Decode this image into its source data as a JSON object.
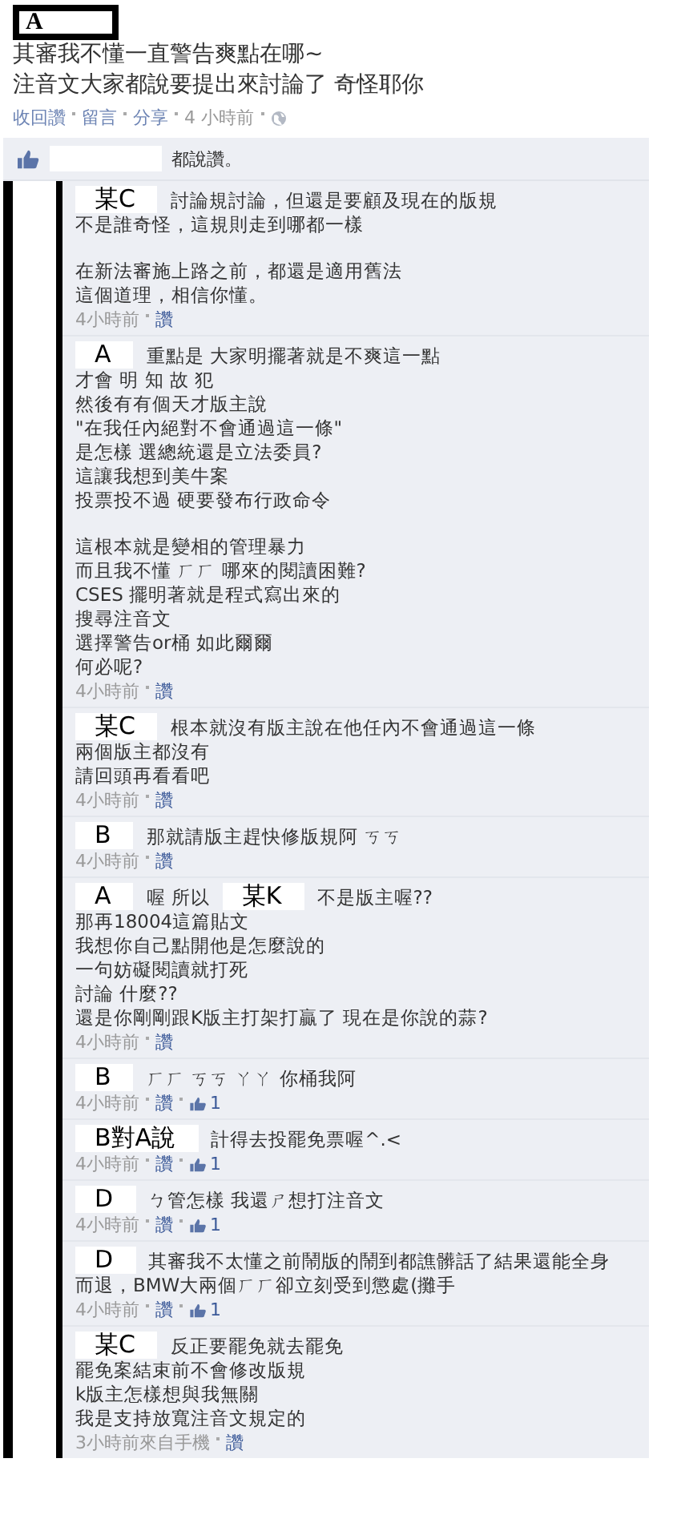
{
  "post": {
    "author": "A",
    "lines": [
      "其審我不懂一直警告爽點在哪~",
      "注音文大家都說要提出來討論了 奇怪耶你"
    ],
    "actions": [
      {
        "kind": "link",
        "text": "收回讚"
      },
      {
        "kind": "link",
        "text": "留言"
      },
      {
        "kind": "link",
        "text": "分享"
      },
      {
        "kind": "time",
        "text": "4 小時前"
      },
      {
        "kind": "globe"
      }
    ]
  },
  "likes_row": {
    "text": "都說讚。"
  },
  "comments": [
    {
      "author": "某C",
      "head": [
        {
          "kind": "text",
          "text": "討論規討論，但還是要顧及現在的版規"
        }
      ],
      "paragraphs": [
        [
          "不是誰奇怪，這規則走到哪都一樣"
        ],
        [
          "在新法審施上路之前，都還是適用舊法",
          "這個道理，相信你懂。"
        ]
      ],
      "time": "4小時前",
      "like": "讚"
    },
    {
      "author": "A",
      "head": [
        {
          "kind": "text",
          "text": "重點是 大家明擺著就是不爽這一點"
        }
      ],
      "paragraphs": [
        [
          "才會 明 知 故 犯",
          "然後有有個天才版主說",
          "\"在我任內絕對不會通過這一條\"",
          "是怎樣 選總統還是立法委員?",
          "這讓我想到美牛案",
          "投票投不過 硬要發布行政命令"
        ],
        [
          "這根本就是變相的管理暴力",
          "而且我不懂 ㄏㄏ 哪來的閱讀困難?",
          "CSES 擺明著就是程式寫出來的",
          "搜尋注音文",
          "選擇警告or桶 如此爾爾",
          "何必呢?"
        ]
      ],
      "time": "4小時前",
      "like": "讚"
    },
    {
      "author": "某C",
      "head": [
        {
          "kind": "text",
          "text": "根本就沒有版主說在他任內不會通過這一條"
        }
      ],
      "paragraphs": [
        [
          "兩個版主都沒有",
          "請回頭再看看吧"
        ]
      ],
      "time": "4小時前",
      "like": "讚"
    },
    {
      "author": "B",
      "head": [
        {
          "kind": "text",
          "text": "那就請版主趕快修版規阿 ㄎㄎ"
        }
      ],
      "time": "4小時前",
      "like": "讚"
    },
    {
      "author": "A",
      "head": [
        {
          "kind": "text",
          "text": "喔 所以"
        },
        {
          "kind": "name",
          "text": "某K"
        },
        {
          "kind": "text",
          "text": "不是版主喔??"
        }
      ],
      "paragraphs": [
        [
          "那再18004這篇貼文",
          "我想你自己點開他是怎麼說的",
          "一句妨礙閱讀就打死",
          "討論 什麼??",
          "還是你剛剛跟K版主打架打贏了 現在是你說的蒜?"
        ]
      ],
      "time": "4小時前",
      "like": "讚"
    },
    {
      "author": "B",
      "head": [
        {
          "kind": "text",
          "text": "ㄏㄏ ㄎㄎ ㄚㄚ 你桶我阿"
        }
      ],
      "time": "4小時前",
      "like": "讚",
      "likes": "1"
    },
    {
      "author": "B對A說",
      "head": [
        {
          "kind": "text",
          "text": "計得去投罷免票喔^.<"
        }
      ],
      "time": "4小時前",
      "like": "讚",
      "likes": "1"
    },
    {
      "author": "D",
      "head": [
        {
          "kind": "text",
          "text": "ㄅ管怎樣 我還ㄕ想打注音文"
        }
      ],
      "time": "4小時前",
      "like": "讚",
      "likes": "1"
    },
    {
      "author": "D",
      "head": [
        {
          "kind": "text",
          "text": "其審我不太懂之前鬧版的鬧到都譙髒話了結果還能全身"
        }
      ],
      "paragraphs": [
        [
          "而退，BMW大兩個ㄏㄏ卻立刻受到懲處(攤手"
        ]
      ],
      "time": "4小時前",
      "like": "讚",
      "likes": "1"
    },
    {
      "author": "某C",
      "head": [
        {
          "kind": "text",
          "text": "反正要罷免就去罷免"
        }
      ],
      "paragraphs": [
        [
          "罷免案結束前不會修改版規",
          "k版主怎樣想與我無關",
          "我是支持放寬注音文規定的"
        ]
      ],
      "time": "3小時前來自手機",
      "like": "讚"
    }
  ]
}
